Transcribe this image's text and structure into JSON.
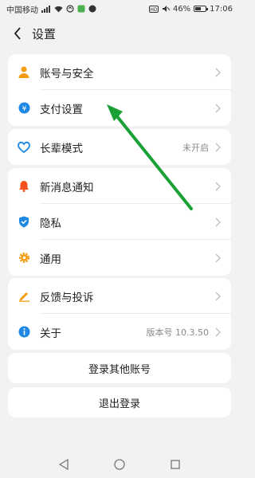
{
  "status_bar": {
    "carrier": "中国移动",
    "battery": "46%",
    "time": "17:06"
  },
  "header": {
    "title": "设置"
  },
  "groups": {
    "account": [
      {
        "label": "账号与安全",
        "icon": "user-icon"
      },
      {
        "label": "支付设置",
        "icon": "yen-icon"
      }
    ],
    "elder": {
      "label": "长辈模式",
      "value": "未开启",
      "icon": "heart-icon"
    },
    "general": [
      {
        "label": "新消息通知",
        "icon": "bell-icon"
      },
      {
        "label": "隐私",
        "icon": "shield-icon"
      },
      {
        "label": "通用",
        "icon": "gear-icon"
      }
    ],
    "about": [
      {
        "label": "反馈与投诉",
        "icon": "pen-icon"
      },
      {
        "label": "关于",
        "value": "版本号 10.3.50",
        "icon": "info-icon"
      }
    ]
  },
  "buttons": {
    "login_other": "登录其他账号",
    "logout": "退出登录"
  },
  "colors": {
    "accent_blue": "#1e88e5",
    "orange": "#f39c12",
    "red": "#f4511e",
    "annotation_green": "#1aa136"
  }
}
